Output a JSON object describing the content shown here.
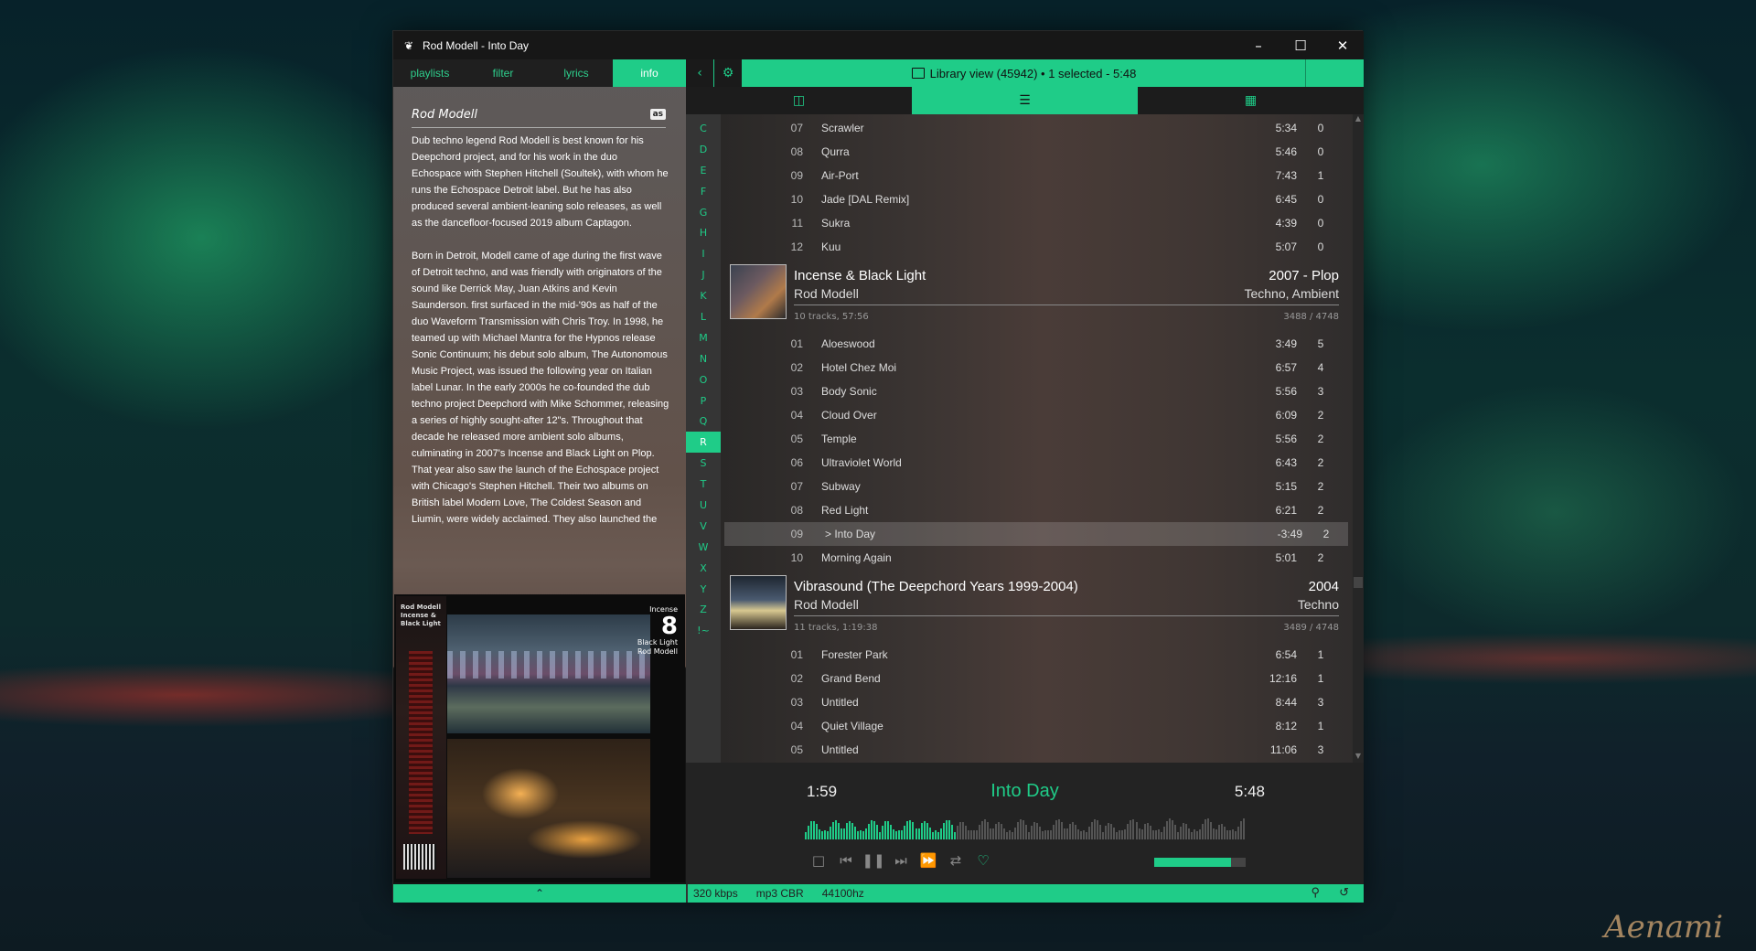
{
  "window": {
    "title": "Rod Modell - Into Day"
  },
  "left_tabs": [
    "playlists",
    "filter",
    "lyrics",
    "info"
  ],
  "info": {
    "artist": "Rod Modell",
    "lastfm_badge": "as",
    "bio": [
      "Dub techno legend Rod Modell is best known for his Deepchord project, and for his work in the duo Echospace with Stephen Hitchell (Soultek), with whom he runs the Echospace Detroit label. But he has also produced several ambient-leaning solo releases, as well as the dancefloor-focused 2019 album Captagon.",
      "Born in Detroit, Modell came of age during the first wave of Detroit techno, and was friendly with originators of the sound like Derrick May, Juan Atkins and Kevin Saunderson. first surfaced in the mid-'90s as half of the duo Waveform Transmission with Chris Troy. In 1998, he teamed up with Michael Mantra for the Hypnos release Sonic Continuum; his debut solo album, The Autonomous Music Project, was issued the following year on Italian label Lunar. In the early 2000s he co-founded the dub techno project Deepchord with Mike Schommer, releasing a series of highly sought-after 12\"s. Throughout that decade he released more ambient solo albums, culminating in 2007's Incense and Black Light on Plop. That year also saw the launch of the Echospace project with Chicago's Stephen Hitchell. Their two albums on British label Modern Love, The Coldest Season and Liumin, were widely acclaimed. They also launched the"
    ],
    "cover": {
      "spine_text": "Rod Modell\nIncense &\nBlack Light",
      "top_word": "Incense",
      "bottom_text": "Black Light\nRod Modell",
      "logo_char": "8"
    }
  },
  "library": {
    "status": "Library view (45942)  •  1 selected - 5:48",
    "letters": [
      "C",
      "D",
      "E",
      "F",
      "G",
      "H",
      "I",
      "J",
      "K",
      "L",
      "M",
      "N",
      "O",
      "P",
      "Q",
      "R",
      "S",
      "T",
      "U",
      "V",
      "W",
      "X",
      "Y",
      "Z",
      "!~"
    ],
    "active_letter": "R",
    "prev_tracks": [
      {
        "n": "07",
        "title": "Scrawler",
        "dur": "5:34",
        "rating": "0"
      },
      {
        "n": "08",
        "title": "Qurra",
        "dur": "5:46",
        "rating": "0"
      },
      {
        "n": "09",
        "title": "Air-Port",
        "dur": "7:43",
        "rating": "1"
      },
      {
        "n": "10",
        "title": "Jade [DAL Remix]",
        "dur": "6:45",
        "rating": "0"
      },
      {
        "n": "11",
        "title": "Sukra",
        "dur": "4:39",
        "rating": "0"
      },
      {
        "n": "12",
        "title": "Kuu",
        "dur": "5:07",
        "rating": "0"
      }
    ],
    "albums": [
      {
        "name": "Incense & Black Light",
        "year_label": "2007 - Plop",
        "artist": "Rod Modell",
        "genre": "Techno, Ambient",
        "info": "10 tracks, 57:56",
        "count": "3488 / 4748",
        "tracks": [
          {
            "n": "01",
            "title": "Aloeswood",
            "dur": "3:49",
            "rating": "5"
          },
          {
            "n": "02",
            "title": "Hotel Chez Moi",
            "dur": "6:57",
            "rating": "4"
          },
          {
            "n": "03",
            "title": "Body Sonic",
            "dur": "5:56",
            "rating": "3"
          },
          {
            "n": "04",
            "title": "Cloud Over",
            "dur": "6:09",
            "rating": "2"
          },
          {
            "n": "05",
            "title": "Temple",
            "dur": "5:56",
            "rating": "2"
          },
          {
            "n": "06",
            "title": "Ultraviolet World",
            "dur": "6:43",
            "rating": "2"
          },
          {
            "n": "07",
            "title": "Subway",
            "dur": "5:15",
            "rating": "2"
          },
          {
            "n": "08",
            "title": "Red Light",
            "dur": "6:21",
            "rating": "2"
          },
          {
            "n": "09",
            "title": ">  Into Day",
            "dur": "-3:49",
            "rating": "2",
            "selected": true
          },
          {
            "n": "10",
            "title": "Morning Again",
            "dur": "5:01",
            "rating": "2"
          }
        ]
      },
      {
        "name": "Vibrasound (The Deepchord Years 1999-2004)",
        "year_label": "2004",
        "artist": "Rod Modell",
        "genre": "Techno",
        "info": "11 tracks, 1:19:38",
        "count": "3489 / 4748",
        "tracks": [
          {
            "n": "01",
            "title": "Forester Park",
            "dur": "6:54",
            "rating": "1"
          },
          {
            "n": "02",
            "title": "Grand Bend",
            "dur": "12:16",
            "rating": "1"
          },
          {
            "n": "03",
            "title": "Untitled",
            "dur": "8:44",
            "rating": "3"
          },
          {
            "n": "04",
            "title": "Quiet Village",
            "dur": "8:12",
            "rating": "1"
          },
          {
            "n": "05",
            "title": "Untitled",
            "dur": "11:06",
            "rating": "3"
          }
        ]
      }
    ]
  },
  "player": {
    "current_time": "1:59",
    "title": "Into Day",
    "total_time": "5:48",
    "progress": 0.34,
    "volume": 0.84
  },
  "statusbar": {
    "bitrate": "320 kbps",
    "codec": "mp3 CBR",
    "samplerate": "44100hz"
  },
  "colors": {
    "accent": "#1fcc88",
    "panel": "#1c1d1e"
  },
  "wallpaper": {
    "signature": "Aenami"
  }
}
